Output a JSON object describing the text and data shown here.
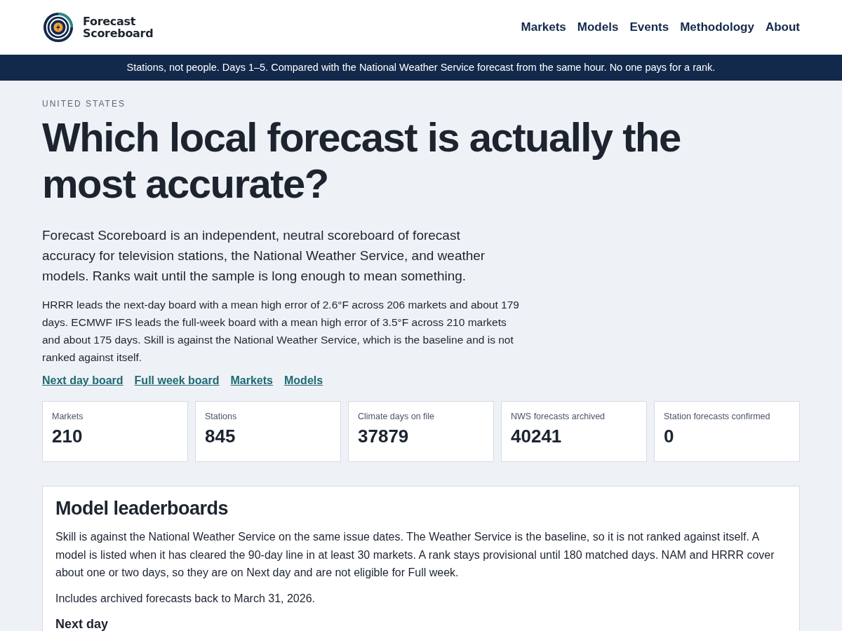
{
  "header": {
    "logo_text": [
      "Forecast",
      "Scoreboard"
    ],
    "nav": [
      {
        "label": "Markets"
      },
      {
        "label": "Models"
      },
      {
        "label": "Events"
      },
      {
        "label": "Methodology"
      },
      {
        "label": "About"
      }
    ]
  },
  "banner": "Stations, not people. Days 1–5. Compared with the National Weather Service forecast from the same hour. No one pays for a rank.",
  "hero": {
    "eyebrow": "UNITED STATES",
    "title": "Which local forecast is actually the most accurate?",
    "lead": "Forecast Scoreboard is an independent, neutral scoreboard of forecast accuracy for television stations, the National Weather Service, and weather models. Ranks wait until the sample is long enough to mean something.",
    "summary": "HRRR leads the next-day board with a mean high error of 2.6°F across 206 markets and about 179 days. ECMWF IFS leads the full-week board with a mean high error of 3.5°F across 210 markets and about 175 days. Skill is against the National Weather Service, which is the baseline and is not ranked against itself.",
    "links": [
      "Next day board",
      "Full week board",
      "Markets",
      "Models"
    ]
  },
  "stats": [
    {
      "label": "Markets",
      "value": "210"
    },
    {
      "label": "Stations",
      "value": "845"
    },
    {
      "label": "Climate days on file",
      "value": "37879"
    },
    {
      "label": "NWS forecasts archived",
      "value": "40241"
    },
    {
      "label": "Station forecasts confirmed",
      "value": "0"
    }
  ],
  "leaderboards": {
    "title": "Model leaderboards",
    "paragraphs": [
      "Skill is against the National Weather Service on the same issue dates. The Weather Service is the baseline, so it is not ranked against itself. A model is listed when it has cleared the 90-day line in at least 30 markets. A rank stays provisional until 180 matched days. NAM and HRRR cover about one or two days, so they are on Next day and are not eligible for Full week.",
      "Includes archived forecasts back to March 31, 2026."
    ],
    "subheading": "Next day"
  }
}
